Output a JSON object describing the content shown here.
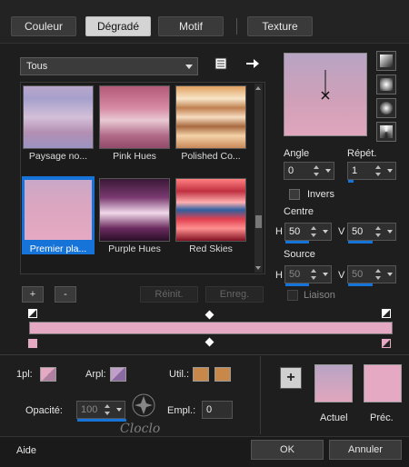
{
  "tabs": [
    "Couleur",
    "Dégradé",
    "Motif",
    "Texture"
  ],
  "active_tab": "Dégradé",
  "category_select": {
    "value": "Tous"
  },
  "gallery": [
    {
      "label": "Paysage no...",
      "gradient": "linear-gradient(to bottom,#b9a6cc 0%,#a6a0cc 20%,#d4c0d8 50%,#b38fb3 75%,#9c94c2 100%)"
    },
    {
      "label": "Pink Hues",
      "gradient": "linear-gradient(to bottom,#b35a78 0%,#d78aa4 35%,#e8c8d2 55%,#b06a88 80%,#944a6a 100%)"
    },
    {
      "label": "Polished Co...",
      "gradient": "linear-gradient(to bottom,#e0a060 0%,#f8e6c8 20%,#c08050 35%,#f6dcc0 50%,#a86a40 65%,#f4d2a8 80%,#c88858 100%)"
    },
    {
      "label": "Premier pla...",
      "gradient": "linear-gradient(to bottom,#c9a8c8 0%,#dca6c0 45%,#e5a9c3 100%)"
    },
    {
      "label": "Purple Hues",
      "gradient": "linear-gradient(to bottom,#3a1838 0%,#7a3a70 30%,#f0d8ea 55%,#6a2a5e 80%,#2a0f28 100%)"
    },
    {
      "label": "Red Skies",
      "gradient": "linear-gradient(to bottom,#ff8080 0%,#c03040 20%,#ffb0b0 38%,#3060a0 50%,#e04050 65%,#ff9090 80%,#801020 100%)"
    }
  ],
  "gallery_buttons": {
    "add": "+",
    "remove": "-",
    "reinit": "Réinit.",
    "enreg": "Enreg."
  },
  "angle": {
    "label": "Angle",
    "value": "0"
  },
  "repet": {
    "label": "Répét.",
    "value": "1"
  },
  "invers_label": "Invers",
  "centre": {
    "label": "Centre",
    "h_label": "H",
    "h_value": "50",
    "v_label": "V",
    "v_value": "50"
  },
  "source": {
    "label": "Source",
    "h_label": "H",
    "h_value": "50",
    "v_label": "V",
    "v_value": "50"
  },
  "liaison_label": "Liaison",
  "gradient_color": "#e5a9c3",
  "bottom": {
    "first_pl_label": "1pl:",
    "arrpl_label": "Arpl:",
    "util_label": "Util.:",
    "util_color": "#c8884a",
    "opacite_label": "Opacité:",
    "opacite_value": "100",
    "empl_label": "Empl.:",
    "empl_value": "0",
    "add_button": "+",
    "actuel_label": "Actuel",
    "prec_label": "Préc."
  },
  "footer": {
    "aide": "Aide",
    "ok": "OK",
    "annuler": "Annuler"
  },
  "watermark": "Cloclo"
}
